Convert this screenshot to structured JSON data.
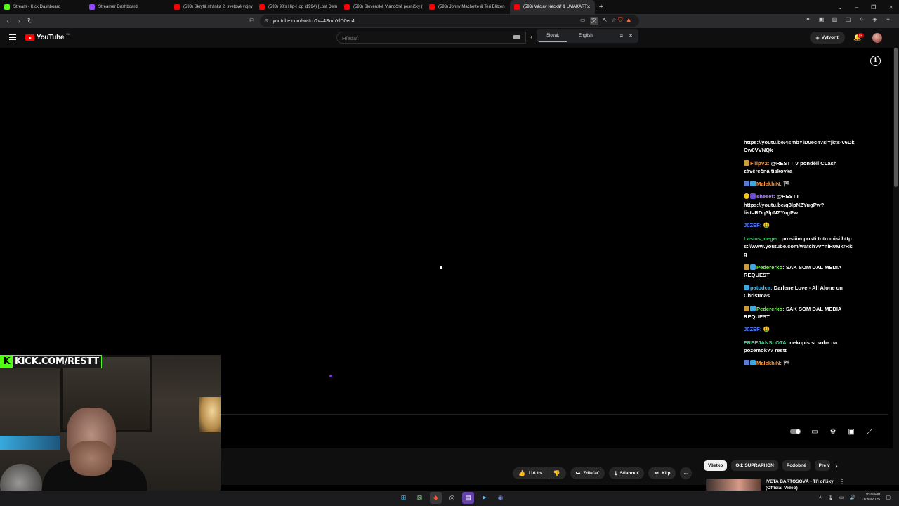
{
  "browser": {
    "tabs": [
      {
        "title": "Stream - Kick Dashboard",
        "fav_color": "#53fc18"
      },
      {
        "title": "Streamer Dashboard",
        "fav_color": "#9146ff"
      },
      {
        "title": "(593) Skrytá stránka 2. svetové vojny",
        "fav_color": "#ff0000"
      },
      {
        "title": "(593) 90's Hip-Hop (1994) [Lost Dem",
        "fav_color": "#ff0000"
      },
      {
        "title": "(593) Slovenské Vianočné pesničky (",
        "fav_color": "#ff0000"
      },
      {
        "title": "(593) Johny Machette & Teri Blitzen",
        "fav_color": "#ff0000"
      },
      {
        "title": "(593) Václav Neckář & UMAKART",
        "fav_color": "#ff0000"
      }
    ],
    "new_tab": "+",
    "url": "youtube.com/watch?v=4SmbYlD0ec4"
  },
  "youtube": {
    "logo_text": "YouTube",
    "country_code": "SK",
    "search_placeholder": "Hľadať",
    "create_label": "Vytvoriť",
    "notif_badge": "9+"
  },
  "translate": {
    "lang_selected": "Slovak",
    "lang_other": "English"
  },
  "chat": {
    "partial_lines": "https://youtu.be/4smbYlD0ec4?si=jkts-v6DkCw0VVNQk",
    "messages": [
      {
        "user": "FilipV2:",
        "user_color": "#ff9a3c",
        "text": "@RESTT V pondělí CLash závěrečná tiskovka"
      },
      {
        "user": "MalekhiN:",
        "user_color": "#ff9a3c",
        "text": "🏁"
      },
      {
        "user": "sheeef:",
        "user_color": "#b38cff",
        "text": "@RESTT https://youtu.be/q3lpNZYugPw?list=RDq3lpNZYugPw"
      },
      {
        "user": "J0ZEF:",
        "user_color": "#4a7dff",
        "text": "🤮"
      },
      {
        "user": "Lasius_neger:",
        "user_color": "#3ccf6b",
        "text": "prosiiim pusti toto misi https://www.youtube.com/watch?v=nlR0MkrRklg"
      },
      {
        "user": "Pedererko:",
        "user_color": "#7fff5a",
        "text": "SAK SOM DAL MEDIA REQUEST"
      },
      {
        "user": "patodca:",
        "user_color": "#42c5ff",
        "text": "Darlene Love - All Alone on Christmas"
      },
      {
        "user": "Pedererko:",
        "user_color": "#7fff5a",
        "text": "SAK SOM DAL MEDIA REQUEST"
      },
      {
        "user": "J0ZEF:",
        "user_color": "#4a7dff",
        "text": "🤮"
      },
      {
        "user": "FREEJANSLOTA:",
        "user_color": "#3cdc8a",
        "text": "nekupis si soba na pozemok?? restt"
      },
      {
        "user": "MalekhiN:",
        "user_color": "#ff9a3c",
        "text": "🏁"
      }
    ]
  },
  "overlay": {
    "kick_k": "K",
    "kick_text": "KICK.COM/RESTT"
  },
  "actions": {
    "likes": "116 tis.",
    "share": "Zdieľať",
    "download": "Stiahnuť",
    "clip": "Klip"
  },
  "chips": [
    "Všetko",
    "Od: SUPRAPHON",
    "Podobné",
    "Pre v"
  ],
  "recommendation": {
    "title": "IVETA BARTOŠOVÁ - Tři oříšky (Official Video)"
  },
  "taskbar": {
    "time": "9:09 PM",
    "date": "11/30/2025"
  }
}
